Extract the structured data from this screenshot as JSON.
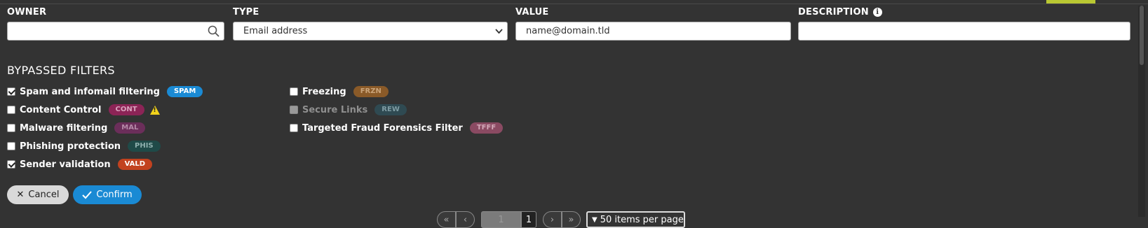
{
  "fields": {
    "owner_label": "OWNER",
    "type_label": "TYPE",
    "value_label": "VALUE",
    "description_label": "DESCRIPTION",
    "owner_value": "",
    "type_selected": "Email address",
    "value_value": "name@domain.tld",
    "description_value": ""
  },
  "bypassed": {
    "title": "BYPASSED FILTERS",
    "items": [
      {
        "label": "Spam and infomail filtering",
        "badge": "SPAM",
        "checked": true,
        "badge_color": "#1a8ad4"
      },
      {
        "label": "Content Control",
        "badge": "CONT",
        "checked": false,
        "badge_color": "#8c2456",
        "warning": true
      },
      {
        "label": "Malware filtering",
        "badge": "MAL",
        "checked": false,
        "badge_color": "#6b2e5a"
      },
      {
        "label": "Phishing protection",
        "badge": "PHIS",
        "checked": false,
        "badge_color": "#1f4a48"
      },
      {
        "label": "Sender validation",
        "badge": "VALD",
        "checked": true,
        "badge_color": "#c2421f"
      },
      {
        "label": "Freezing",
        "badge": "FRZN",
        "checked": false,
        "badge_color": "#8a5a28"
      },
      {
        "label": "Secure Links",
        "badge": "REW",
        "checked": false,
        "disabled": true,
        "badge_color": "#2f4a52"
      },
      {
        "label": "Targeted Fraud Forensics Filter",
        "badge": "TFFF",
        "checked": false,
        "badge_color": "#8a4a62"
      }
    ]
  },
  "actions": {
    "cancel_label": "Cancel",
    "confirm_label": "Confirm"
  },
  "pagination": {
    "first": "«",
    "prev": "‹",
    "page_input": "1",
    "total_pages": "1",
    "next": "›",
    "last": "»",
    "per_page_label": "50 items per page"
  },
  "colors": {
    "background": "#333333",
    "accent": "#b9c832",
    "primary_button": "#1a8ad4"
  }
}
